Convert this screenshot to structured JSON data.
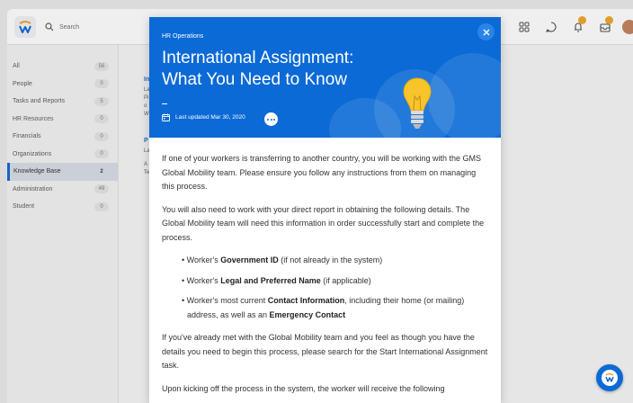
{
  "app": {
    "search_placeholder": "Search"
  },
  "sidebar": {
    "items": [
      {
        "label": "All",
        "count": "56"
      },
      {
        "label": "People",
        "count": "0"
      },
      {
        "label": "Tasks and Reports",
        "count": "5"
      },
      {
        "label": "HR Resources",
        "count": "0"
      },
      {
        "label": "Financials",
        "count": "0"
      },
      {
        "label": "Organizations",
        "count": "0"
      },
      {
        "label": "Knowledge Base",
        "count": "2"
      },
      {
        "label": "Administration",
        "count": "49"
      },
      {
        "label": "Student",
        "count": "0"
      }
    ],
    "active_index": 6
  },
  "peek": {
    "l1": "In",
    "l2": "La",
    "l3": "Pi",
    "l4": "o",
    "l5": "W",
    "l6": "P",
    "l7": "La",
    "l8": "A",
    "l9": "Te"
  },
  "modal": {
    "department": "HR Operations",
    "title": "International Assignment: What You Need to Know",
    "dash": "—",
    "updated": "Last updated Mar 30, 2020",
    "paragraph1": "If one of your workers is transferring to another country, you will be working with the GMS Global Mobility team. Please ensure you follow any instructions from them on managing this process.",
    "paragraph2": "You will also need to work with your direct report in obtaining the following details. The Global Mobility team will need this information in order successfully start and complete the process.",
    "bullets": [
      {
        "pre": "• Worker's ",
        "bold": "Government ID",
        "post": " (if not already in the system)",
        "bold2": "",
        "post2": ""
      },
      {
        "pre": "• Worker's ",
        "bold": "Legal and Preferred Name",
        "post": " (if applicable)",
        "bold2": "",
        "post2": ""
      },
      {
        "pre": "• Worker's most current ",
        "bold": "Contact Information",
        "post": ", including their home (or mailing) address, as well as an ",
        "bold2": "Emergency Contact",
        "post2": ""
      }
    ],
    "paragraph3": "If you've already met with the Global Mobility team and you feel as though you have the details you need to begin this process, please search for the Start International Assignment task.",
    "paragraph4": "Upon kicking off the process in the system, the worker will receive the following"
  },
  "colors": {
    "brand_blue": "#0b6ad6",
    "notification": "#f0a21c"
  },
  "icons": {
    "close": "close-icon",
    "calendar": "calendar-icon",
    "more": "more-icon",
    "bulb": "lightbulb-icon"
  }
}
